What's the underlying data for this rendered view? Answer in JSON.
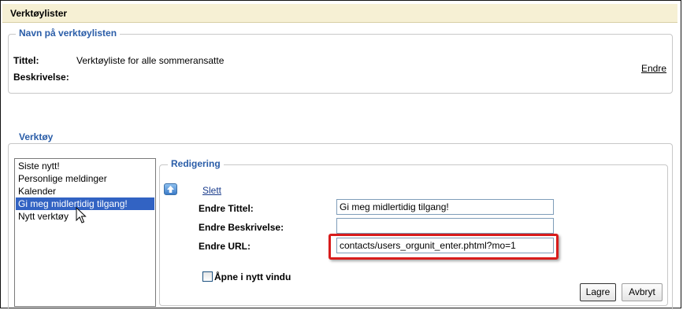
{
  "window": {
    "title": "Verktøylister"
  },
  "list_section": {
    "legend": "Navn på verktøylisten",
    "title_label": "Tittel:",
    "title_value": "Verktøyliste for alle sommeransatte",
    "description_label": "Beskrivelse:",
    "edit_link": "Endre"
  },
  "tools_section": {
    "legend": "Verktøy",
    "tools": [
      {
        "label": "Siste nytt!",
        "selected": false
      },
      {
        "label": "Personlige meldinger",
        "selected": false
      },
      {
        "label": "Kalender",
        "selected": false
      },
      {
        "label": "Gi meg midlertidig tilgang!",
        "selected": true
      },
      {
        "label": "Nytt verktøy",
        "selected": false
      }
    ]
  },
  "editing": {
    "legend": "Redigering",
    "delete_link": "Slett",
    "title_label": "Endre Tittel:",
    "title_value": "Gi meg midlertidig tilgang!",
    "description_label": "Endre Beskrivelse:",
    "description_value": "",
    "url_label": "Endre URL:",
    "url_value": "contacts/users_orgunit_enter.phtml?mo=1",
    "new_window_label": "Åpne i nytt vindu",
    "new_window_checked": false,
    "save_button": "Lagre",
    "cancel_button": "Avbryt"
  },
  "colors": {
    "legend_text": "#2a5da8",
    "title_bar": "#f6f0d4",
    "selected_item": "#3263c3",
    "highlight_box": "#d81c1c"
  }
}
